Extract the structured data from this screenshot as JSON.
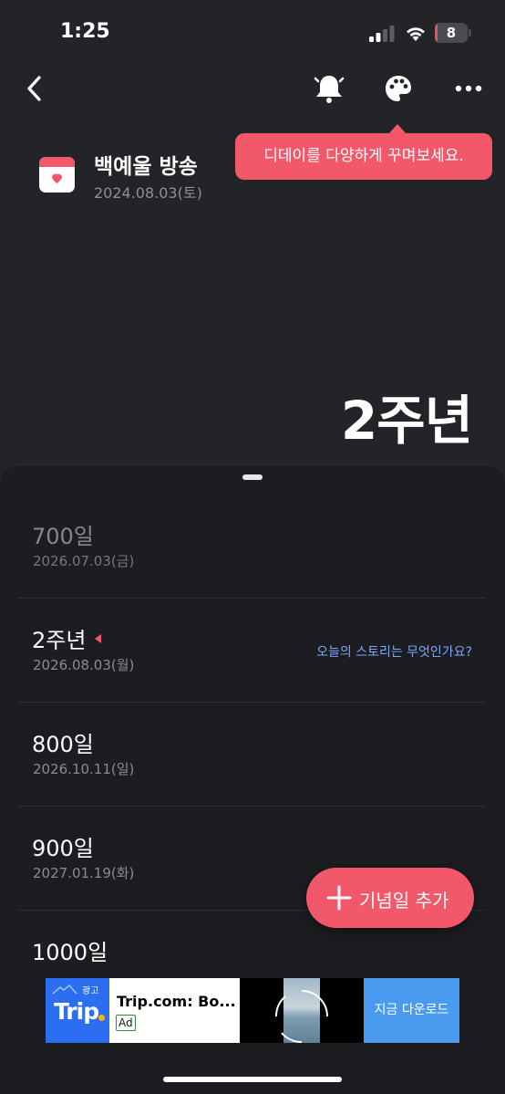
{
  "status_bar": {
    "time": "1:25",
    "battery_level": "8",
    "battery_fraction": 0.08,
    "battery_color": "#e5505c"
  },
  "topbar": {
    "back_icon": "chevron-left-icon",
    "bell_icon": "bell-icon",
    "palette_icon": "palette-icon",
    "more_icon": "more-horizontal-icon"
  },
  "tooltip": {
    "text": "디데이를 다양하게 꾸며보세요."
  },
  "event": {
    "icon": "calendar-check-icon",
    "title": "백예울 방송",
    "date": "2024.08.03(토)"
  },
  "current_milestone": "2주년",
  "milestones": [
    {
      "label": "700일",
      "date": "2026.07.03(금)",
      "state": "past"
    },
    {
      "label": "2주년",
      "date": "2026.08.03(월)",
      "state": "current",
      "story_prompt": "오늘의 스토리는 무엇인가요?"
    },
    {
      "label": "800일",
      "date": "2026.10.11(일)",
      "state": "upcoming"
    },
    {
      "label": "900일",
      "date": "2027.01.19(화)",
      "state": "upcoming"
    },
    {
      "label": "1000일",
      "date": "",
      "state": "upcoming"
    }
  ],
  "fab": {
    "icon": "plus-icon",
    "label": "기념일 추가"
  },
  "ad": {
    "tag": "광고",
    "logo_text": "Trip",
    "title": "Trip.com: Bo...",
    "badge": "Ad",
    "cta": "지금 다운로드"
  },
  "colors": {
    "background": "#232428",
    "sheet": "#1c1d20",
    "accent": "#f3586a",
    "link": "#7da6ff",
    "muted_text": "#8a8b90"
  }
}
